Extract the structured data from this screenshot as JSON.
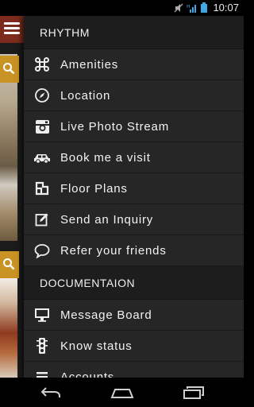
{
  "status_bar": {
    "time": "10:07",
    "icons": [
      "mute-icon",
      "signal-icon",
      "battery-icon"
    ]
  },
  "sections": [
    {
      "title": "RHYTHM",
      "items": [
        {
          "label": "Amenities",
          "icon": "command-icon"
        },
        {
          "label": "Location",
          "icon": "compass-icon"
        },
        {
          "label": "Live Photo Stream",
          "icon": "instagram-icon"
        },
        {
          "label": "Book me a visit",
          "icon": "car-icon"
        },
        {
          "label": "Floor Plans",
          "icon": "floor-plan-icon"
        },
        {
          "label": "Send an Inquiry",
          "icon": "edit-icon"
        },
        {
          "label": "Refer your friends",
          "icon": "chat-bubble-icon"
        }
      ]
    },
    {
      "title": "DOCUMENTAION",
      "items": [
        {
          "label": "Message Board",
          "icon": "monitor-icon"
        },
        {
          "label": "Know status",
          "icon": "traffic-light-icon"
        },
        {
          "label": "Accounts",
          "icon": "list-icon"
        }
      ]
    }
  ],
  "colors": {
    "drawer_bg": "#262626",
    "header_bg": "#1d1d1d",
    "brand_red": "#7e2b1e",
    "search_gold": "#c89322"
  }
}
